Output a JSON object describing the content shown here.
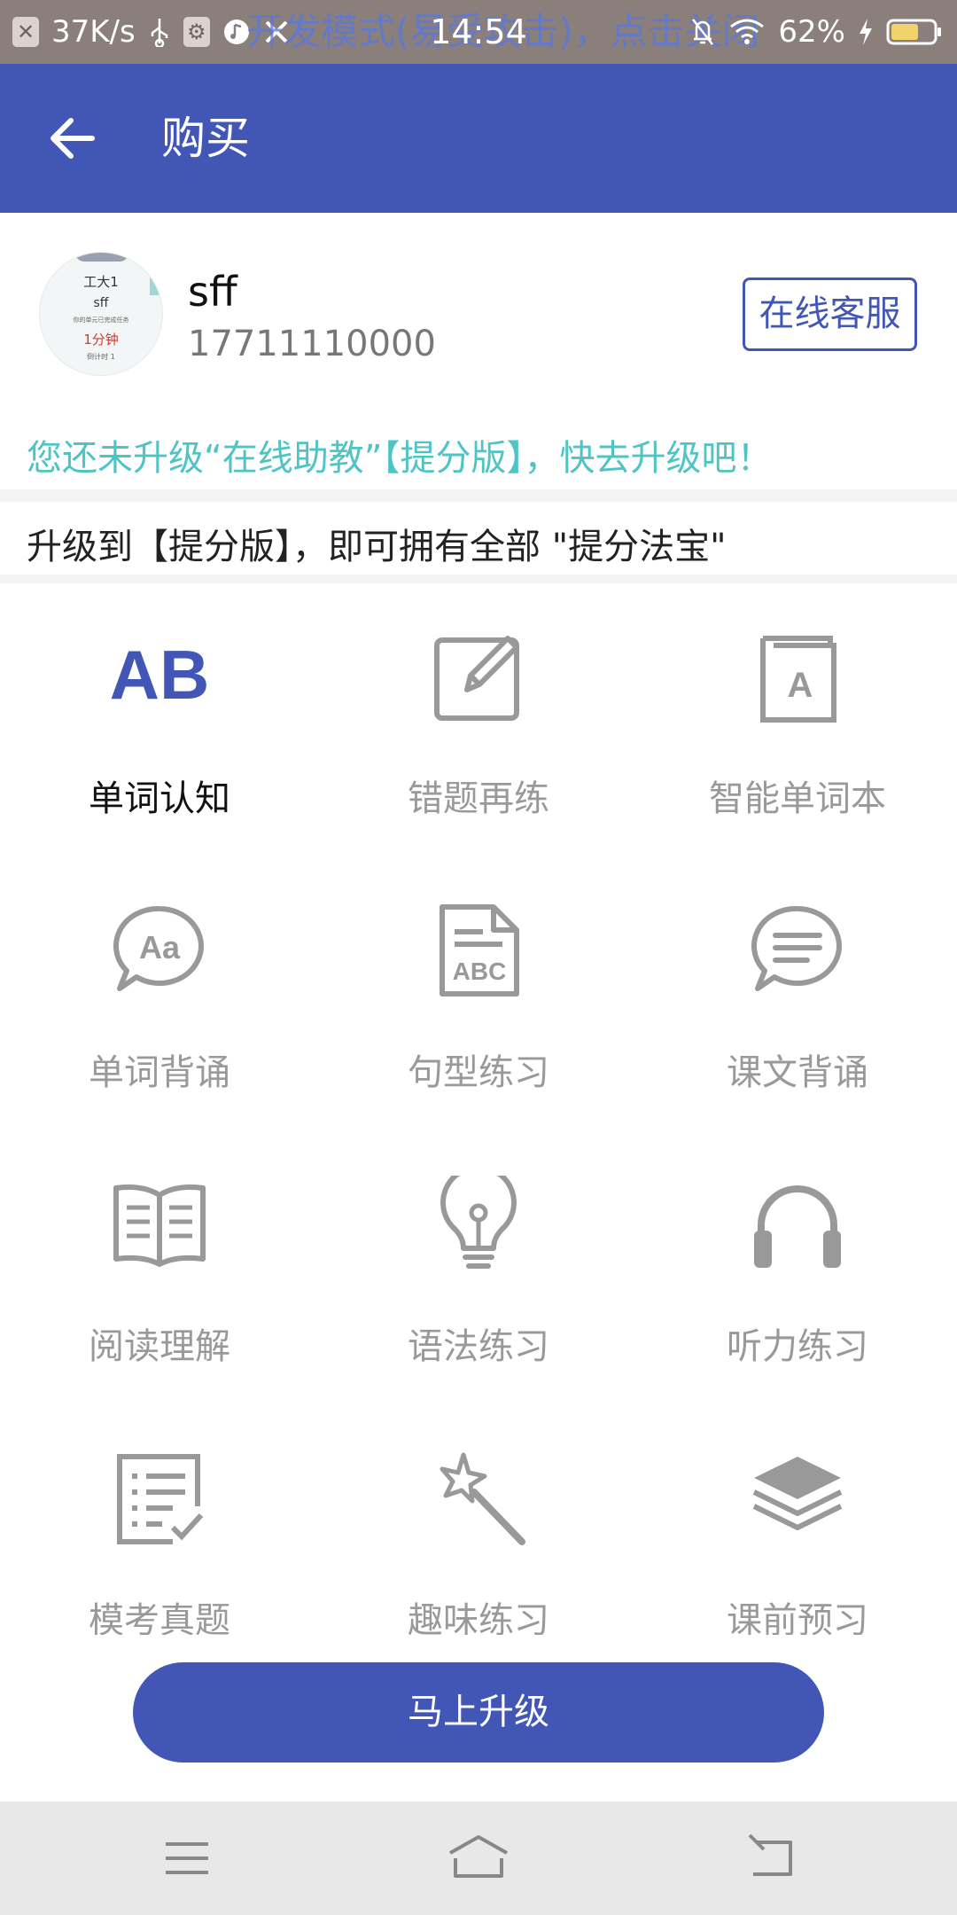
{
  "status_bar": {
    "speed": "37K/s",
    "time": "14:54",
    "overlay_text": "开发模式(易受攻击)，点击关闭",
    "battery": "62%"
  },
  "app_bar": {
    "title": "购买"
  },
  "profile": {
    "name": "sff",
    "phone": "17711110000",
    "service_button": "在线客服",
    "avatar_lines": [
      "工大1",
      "sff",
      "你的单元已完成任务",
      "1分钟",
      "倒计时 1"
    ]
  },
  "notice": "您还未升级“在线助教”【提分版】，快去升级吧！",
  "subheading": "升级到【提分版】，即可拥有全部 \"提分法宝\"",
  "features": [
    {
      "label": "单词认知",
      "icon": "ab-icon"
    },
    {
      "label": "错题再练",
      "icon": "edit-icon"
    },
    {
      "label": "智能单词本",
      "icon": "notebook-icon"
    },
    {
      "label": "单词背诵",
      "icon": "chat-aa-icon"
    },
    {
      "label": "句型练习",
      "icon": "abc-document-icon"
    },
    {
      "label": "课文背诵",
      "icon": "chat-lines-icon"
    },
    {
      "label": "阅读理解",
      "icon": "open-book-icon"
    },
    {
      "label": "语法练习",
      "icon": "lightbulb-icon"
    },
    {
      "label": "听力练习",
      "icon": "headphones-icon"
    },
    {
      "label": "模考真题",
      "icon": "checklist-icon"
    },
    {
      "label": "趣味练习",
      "icon": "magic-wand-icon"
    },
    {
      "label": "课前预习",
      "icon": "layers-icon"
    }
  ],
  "upgrade_button": "马上升级",
  "colors": {
    "primary": "#4257b5",
    "notice": "#4fc4c4",
    "inactive": "#999999"
  }
}
